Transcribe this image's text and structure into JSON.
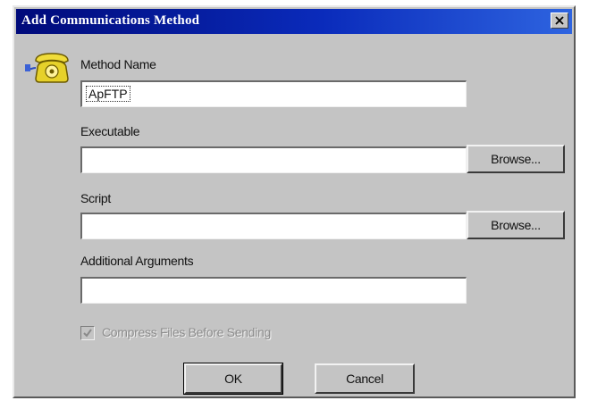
{
  "dialog": {
    "title": "Add Communications Method",
    "close_label": "✕"
  },
  "method_name": {
    "label": "Method Name",
    "value": "ApFTP"
  },
  "executable": {
    "label": "Executable",
    "value": "",
    "browse_label": "Browse..."
  },
  "script": {
    "label": "Script",
    "value": "",
    "browse_label": "Browse..."
  },
  "additional_arguments": {
    "label": "Additional Arguments",
    "value": ""
  },
  "compress": {
    "label": "Compress Files Before Sending",
    "checked": true,
    "enabled": false
  },
  "buttons": {
    "ok_label": "OK",
    "cancel_label": "Cancel"
  },
  "icons": {
    "dialog_icon": "telephone-icon",
    "close": "close-icon",
    "check": "checkmark-icon"
  }
}
